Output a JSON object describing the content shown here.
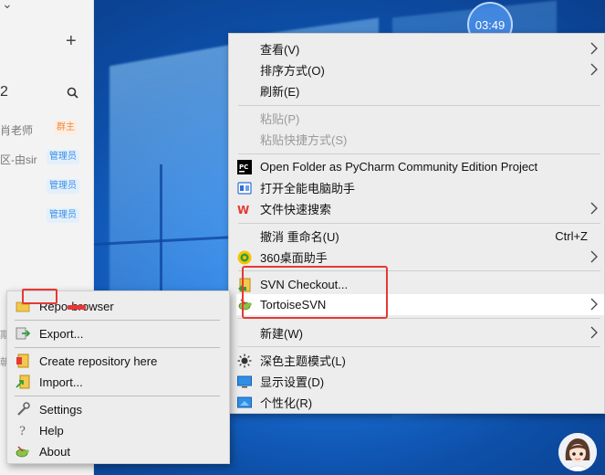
{
  "clock": {
    "time": "03:49"
  },
  "chat_panel": {
    "plus": "+",
    "number": "2",
    "members": [
      {
        "name": "肖老师",
        "badge": "群主",
        "type": "owner"
      },
      {
        "name": "区-由sir",
        "badge": "管理员",
        "type": "admin"
      },
      {
        "name": "",
        "badge": "管理员",
        "type": "admin"
      },
      {
        "name": "",
        "badge": "管理员",
        "type": "admin"
      }
    ],
    "fragments": [
      "期",
      "朝"
    ]
  },
  "context_menu": {
    "items": [
      {
        "label": "查看(V)",
        "has_submenu": true
      },
      {
        "label": "排序方式(O)",
        "has_submenu": true
      },
      {
        "label": "刷新(E)"
      },
      {
        "label": "粘贴(P)",
        "disabled": true
      },
      {
        "label": "粘贴快捷方式(S)",
        "disabled": true
      },
      {
        "label": "Open Folder as PyCharm Community Edition Project",
        "icon": "pycharm-icon"
      },
      {
        "label": "打开全能电脑助手",
        "icon": "assistant-icon"
      },
      {
        "label": "文件快速搜索",
        "icon": "wps-icon",
        "has_submenu": true
      },
      {
        "label": "撤消 重命名(U)",
        "accelerator": "Ctrl+Z"
      },
      {
        "label": "360桌面助手",
        "icon": "360-icon",
        "has_submenu": true
      },
      {
        "label": "SVN Checkout...",
        "icon": "svn-checkout-icon"
      },
      {
        "label": "TortoiseSVN",
        "icon": "tortoisesvn-icon",
        "has_submenu": true
      },
      {
        "label": "新建(W)",
        "has_submenu": true
      },
      {
        "label": "深色主题模式(L)",
        "icon": "brightness-icon"
      },
      {
        "label": "显示设置(D)",
        "icon": "display-icon"
      },
      {
        "label": "个性化(R)",
        "icon": "personalize-icon"
      }
    ]
  },
  "svn_submenu": {
    "items": [
      {
        "label": "Repo-browser",
        "icon": "repo-browser-icon"
      },
      {
        "label": "Export...",
        "icon": "export-icon"
      },
      {
        "label": "Create repository here",
        "icon": "create-repo-icon"
      },
      {
        "label": "Import...",
        "icon": "import-icon"
      },
      {
        "label": "Settings",
        "icon": "settings-icon"
      },
      {
        "label": "Help",
        "icon": "help-icon"
      },
      {
        "label": "About",
        "icon": "about-icon"
      }
    ]
  },
  "colors": {
    "highlight_red": "#e53935",
    "menu_bg": "#ededed",
    "desktop_blue": "#1a6fd6"
  }
}
